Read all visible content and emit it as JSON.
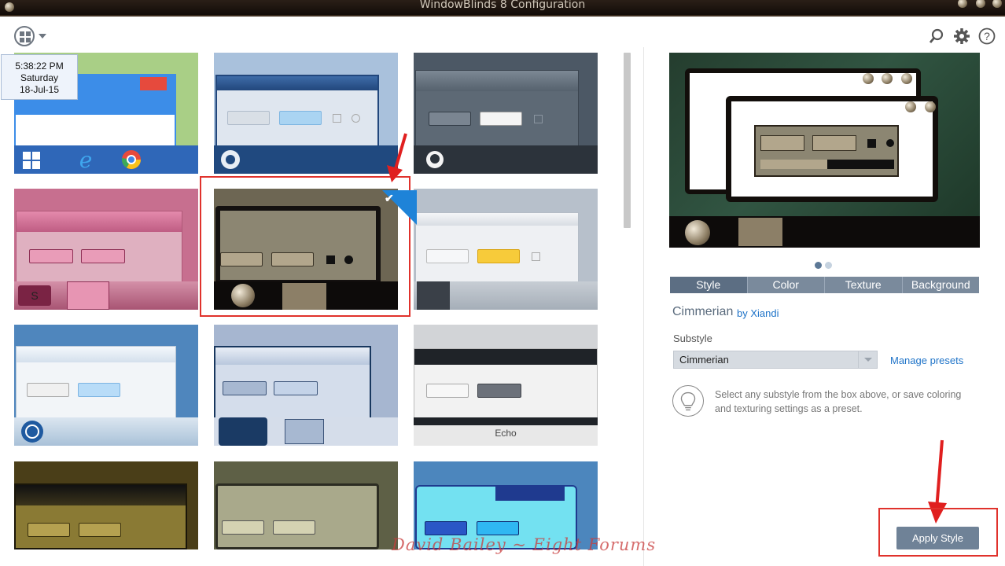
{
  "window": {
    "title": "WindowBlinds 8 Configuration"
  },
  "clock": {
    "time": "5:38:22 PM",
    "day": "Saturday",
    "date": "18-Jul-15"
  },
  "toolbar": {
    "menu_icon": "grid-menu-icon",
    "icons": [
      "search-icon",
      "gear-icon",
      "help-icon"
    ]
  },
  "gallery": {
    "echo_label": "Echo",
    "selected_index": 4
  },
  "preview": {
    "page_dots": 2,
    "active_dot": 0
  },
  "tabs": [
    "Style",
    "Color",
    "Texture",
    "Background"
  ],
  "active_tab": "Style",
  "theme": {
    "name": "Cimmerian",
    "author": "by Xiandi"
  },
  "substyle": {
    "label": "Substyle",
    "value": "Cimmerian",
    "manage_label": "Manage presets"
  },
  "hint": "Select any substyle from the box above, or save coloring and texturing settings as a preset.",
  "apply_button": "Apply Style",
  "watermark": "David Bailey ~ Eight Forums",
  "colors": {
    "accent": "#1e83d8",
    "tab": "#7a8a9c",
    "tab_active": "#5c6e83",
    "highlight": "#e0322c"
  }
}
